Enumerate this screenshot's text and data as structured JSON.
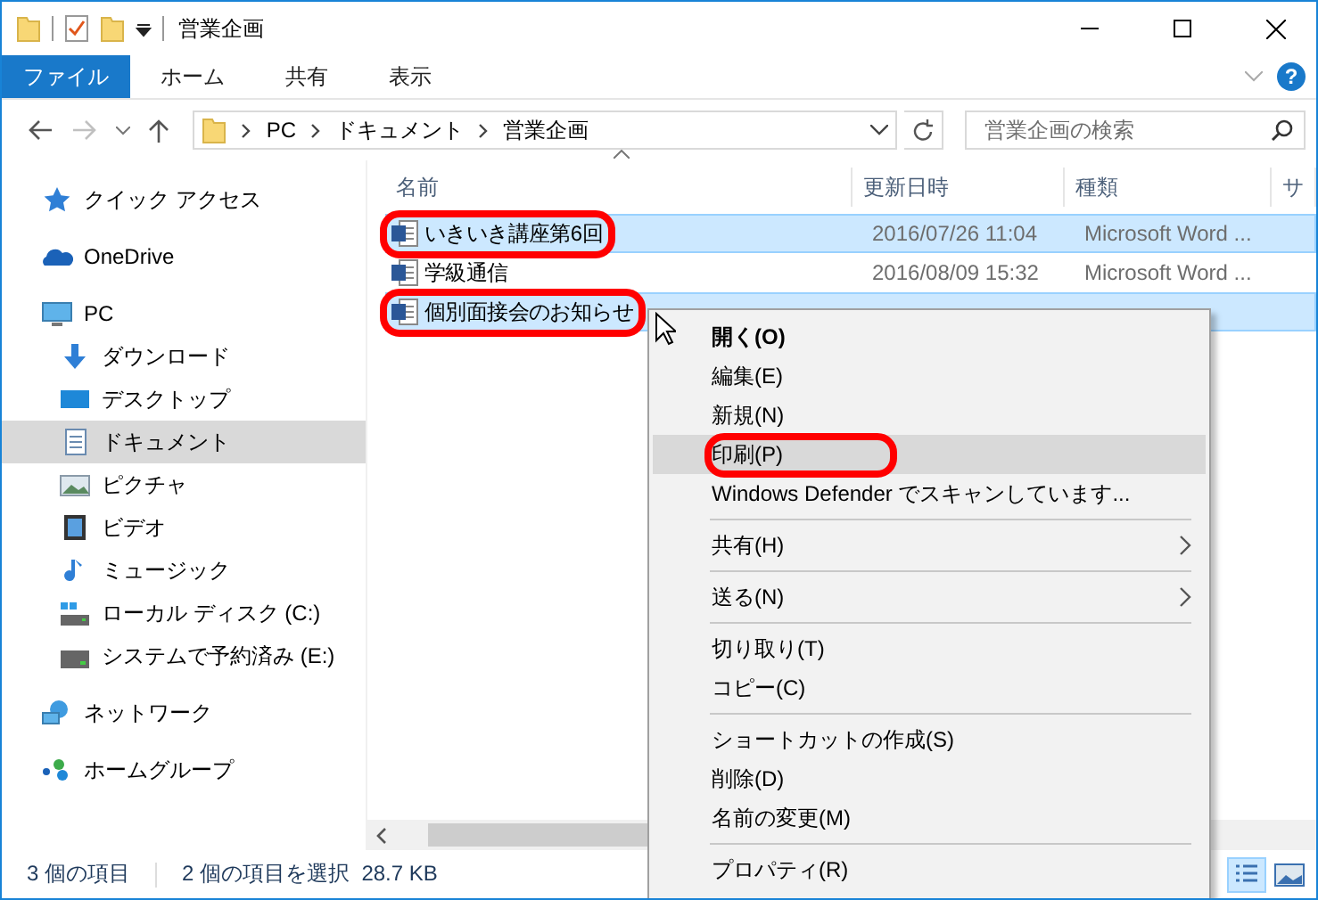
{
  "window": {
    "title": "営業企画"
  },
  "ribbon": {
    "tabs": [
      {
        "label": "ファイル",
        "selected": true
      },
      {
        "label": "ホーム",
        "selected": false
      },
      {
        "label": "共有",
        "selected": false
      },
      {
        "label": "表示",
        "selected": false
      }
    ],
    "help": "?"
  },
  "address": {
    "crumbs": [
      "PC",
      "ドキュメント",
      "営業企画"
    ]
  },
  "search": {
    "placeholder": "営業企画の検索"
  },
  "sidebar": {
    "items": [
      {
        "label": "クイック アクセス",
        "selected": false
      },
      {
        "label": "OneDrive",
        "selected": false
      },
      {
        "label": "PC",
        "selected": false,
        "children": [
          {
            "label": "ダウンロード",
            "selected": false
          },
          {
            "label": "デスクトップ",
            "selected": false
          },
          {
            "label": "ドキュメント",
            "selected": true
          },
          {
            "label": "ピクチャ",
            "selected": false
          },
          {
            "label": "ビデオ",
            "selected": false
          },
          {
            "label": "ミュージック",
            "selected": false
          },
          {
            "label": "ローカル ディスク (C:)",
            "selected": false
          },
          {
            "label": "システムで予約済み (E:)",
            "selected": false
          }
        ]
      },
      {
        "label": "ネットワーク",
        "selected": false
      },
      {
        "label": "ホームグループ",
        "selected": false
      }
    ]
  },
  "table": {
    "columns": [
      "名前",
      "更新日時",
      "種類",
      "サ"
    ],
    "rows": [
      {
        "name": "いきいき講座第6回",
        "modified": "2016/07/26 11:04",
        "type": "Microsoft Word ...",
        "selected": true,
        "highlighted": true
      },
      {
        "name": "学級通信",
        "modified": "2016/08/09 15:32",
        "type": "Microsoft Word ...",
        "selected": false,
        "highlighted": false
      },
      {
        "name": "個別面接会のお知らせ",
        "selected": true,
        "highlighted": true
      }
    ]
  },
  "context_menu": {
    "items": [
      {
        "kind": "item",
        "label": "開く(O)",
        "default": true,
        "selected": false,
        "highlighted": false,
        "submenu": false
      },
      {
        "kind": "item",
        "label": "編集(E)",
        "default": false,
        "selected": false,
        "highlighted": false,
        "submenu": false
      },
      {
        "kind": "item",
        "label": "新規(N)",
        "default": false,
        "selected": false,
        "highlighted": false,
        "submenu": false
      },
      {
        "kind": "item",
        "label": "印刷(P)",
        "default": false,
        "selected": true,
        "highlighted": true,
        "submenu": false
      },
      {
        "kind": "item",
        "label": "Windows Defender でスキャンしています...",
        "default": false,
        "selected": false,
        "highlighted": false,
        "submenu": false
      },
      {
        "kind": "separator"
      },
      {
        "kind": "item",
        "label": "共有(H)",
        "default": false,
        "selected": false,
        "highlighted": false,
        "submenu": true
      },
      {
        "kind": "separator"
      },
      {
        "kind": "item",
        "label": "送る(N)",
        "default": false,
        "selected": false,
        "highlighted": false,
        "submenu": true
      },
      {
        "kind": "separator"
      },
      {
        "kind": "item",
        "label": "切り取り(T)",
        "default": false,
        "selected": false,
        "highlighted": false,
        "submenu": false
      },
      {
        "kind": "item",
        "label": "コピー(C)",
        "default": false,
        "selected": false,
        "highlighted": false,
        "submenu": false
      },
      {
        "kind": "separator"
      },
      {
        "kind": "item",
        "label": "ショートカットの作成(S)",
        "default": false,
        "selected": false,
        "highlighted": false,
        "submenu": false
      },
      {
        "kind": "item",
        "label": "削除(D)",
        "default": false,
        "selected": false,
        "highlighted": false,
        "submenu": false
      },
      {
        "kind": "item",
        "label": "名前の変更(M)",
        "default": false,
        "selected": false,
        "highlighted": false,
        "submenu": false
      },
      {
        "kind": "separator"
      },
      {
        "kind": "item",
        "label": "プロパティ(R)",
        "default": false,
        "selected": false,
        "highlighted": false,
        "submenu": false
      }
    ]
  },
  "status_bar": {
    "count": "3 個の項目",
    "selection": "2 個の項目を選択  28.7 KB"
  }
}
